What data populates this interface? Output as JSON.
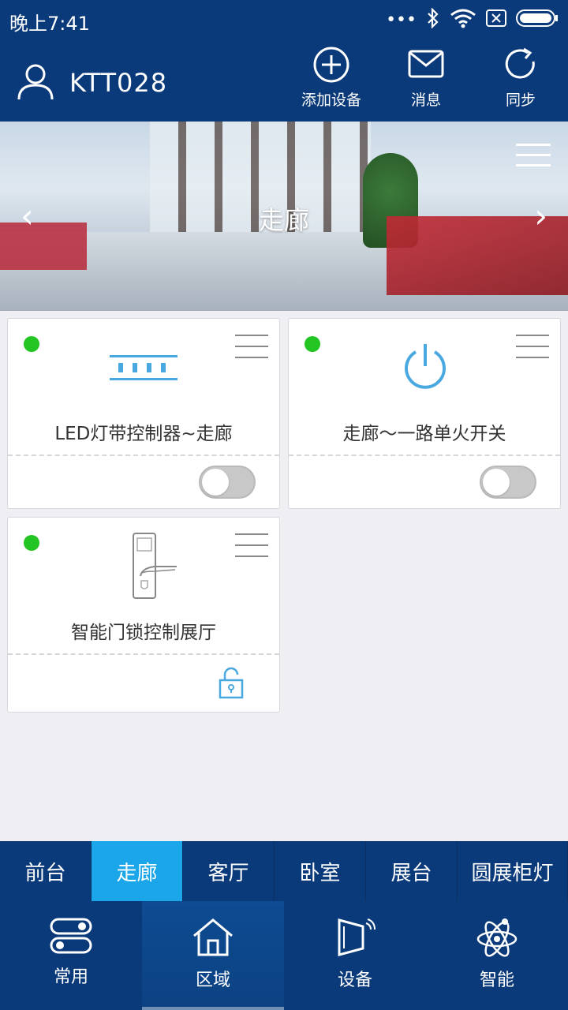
{
  "status_bar": {
    "time": "晚上7:41"
  },
  "header": {
    "username": "KTT028",
    "buttons": [
      {
        "label": "添加设备",
        "icon": "plus-circle-icon"
      },
      {
        "label": "消息",
        "icon": "envelope-icon"
      },
      {
        "label": "同步",
        "icon": "refresh-icon"
      }
    ]
  },
  "banner": {
    "title": "走廊"
  },
  "devices": [
    {
      "name": "LED灯带控制器~走廊",
      "online": true,
      "control": "toggle",
      "state": "off"
    },
    {
      "name": "走廊～一路单火开关",
      "online": true,
      "control": "toggle",
      "state": "off"
    },
    {
      "name": "智能门锁控制展厅",
      "online": true,
      "control": "lock",
      "state": "unlocked"
    }
  ],
  "area_tabs": [
    "前台",
    "走廊",
    "客厅",
    "卧室",
    "展台",
    "圆展柜灯"
  ],
  "active_area": "走廊",
  "bottom_nav": [
    {
      "label": "常用",
      "icon": "toggles-icon"
    },
    {
      "label": "区域",
      "icon": "home-icon"
    },
    {
      "label": "设备",
      "icon": "device-icon"
    },
    {
      "label": "智能",
      "icon": "atom-icon"
    }
  ],
  "active_nav": "区域",
  "colors": {
    "primary": "#0a3a7a",
    "accent": "#1aa6e8",
    "online": "#22c522",
    "icon_blue": "#4aa8e0"
  }
}
